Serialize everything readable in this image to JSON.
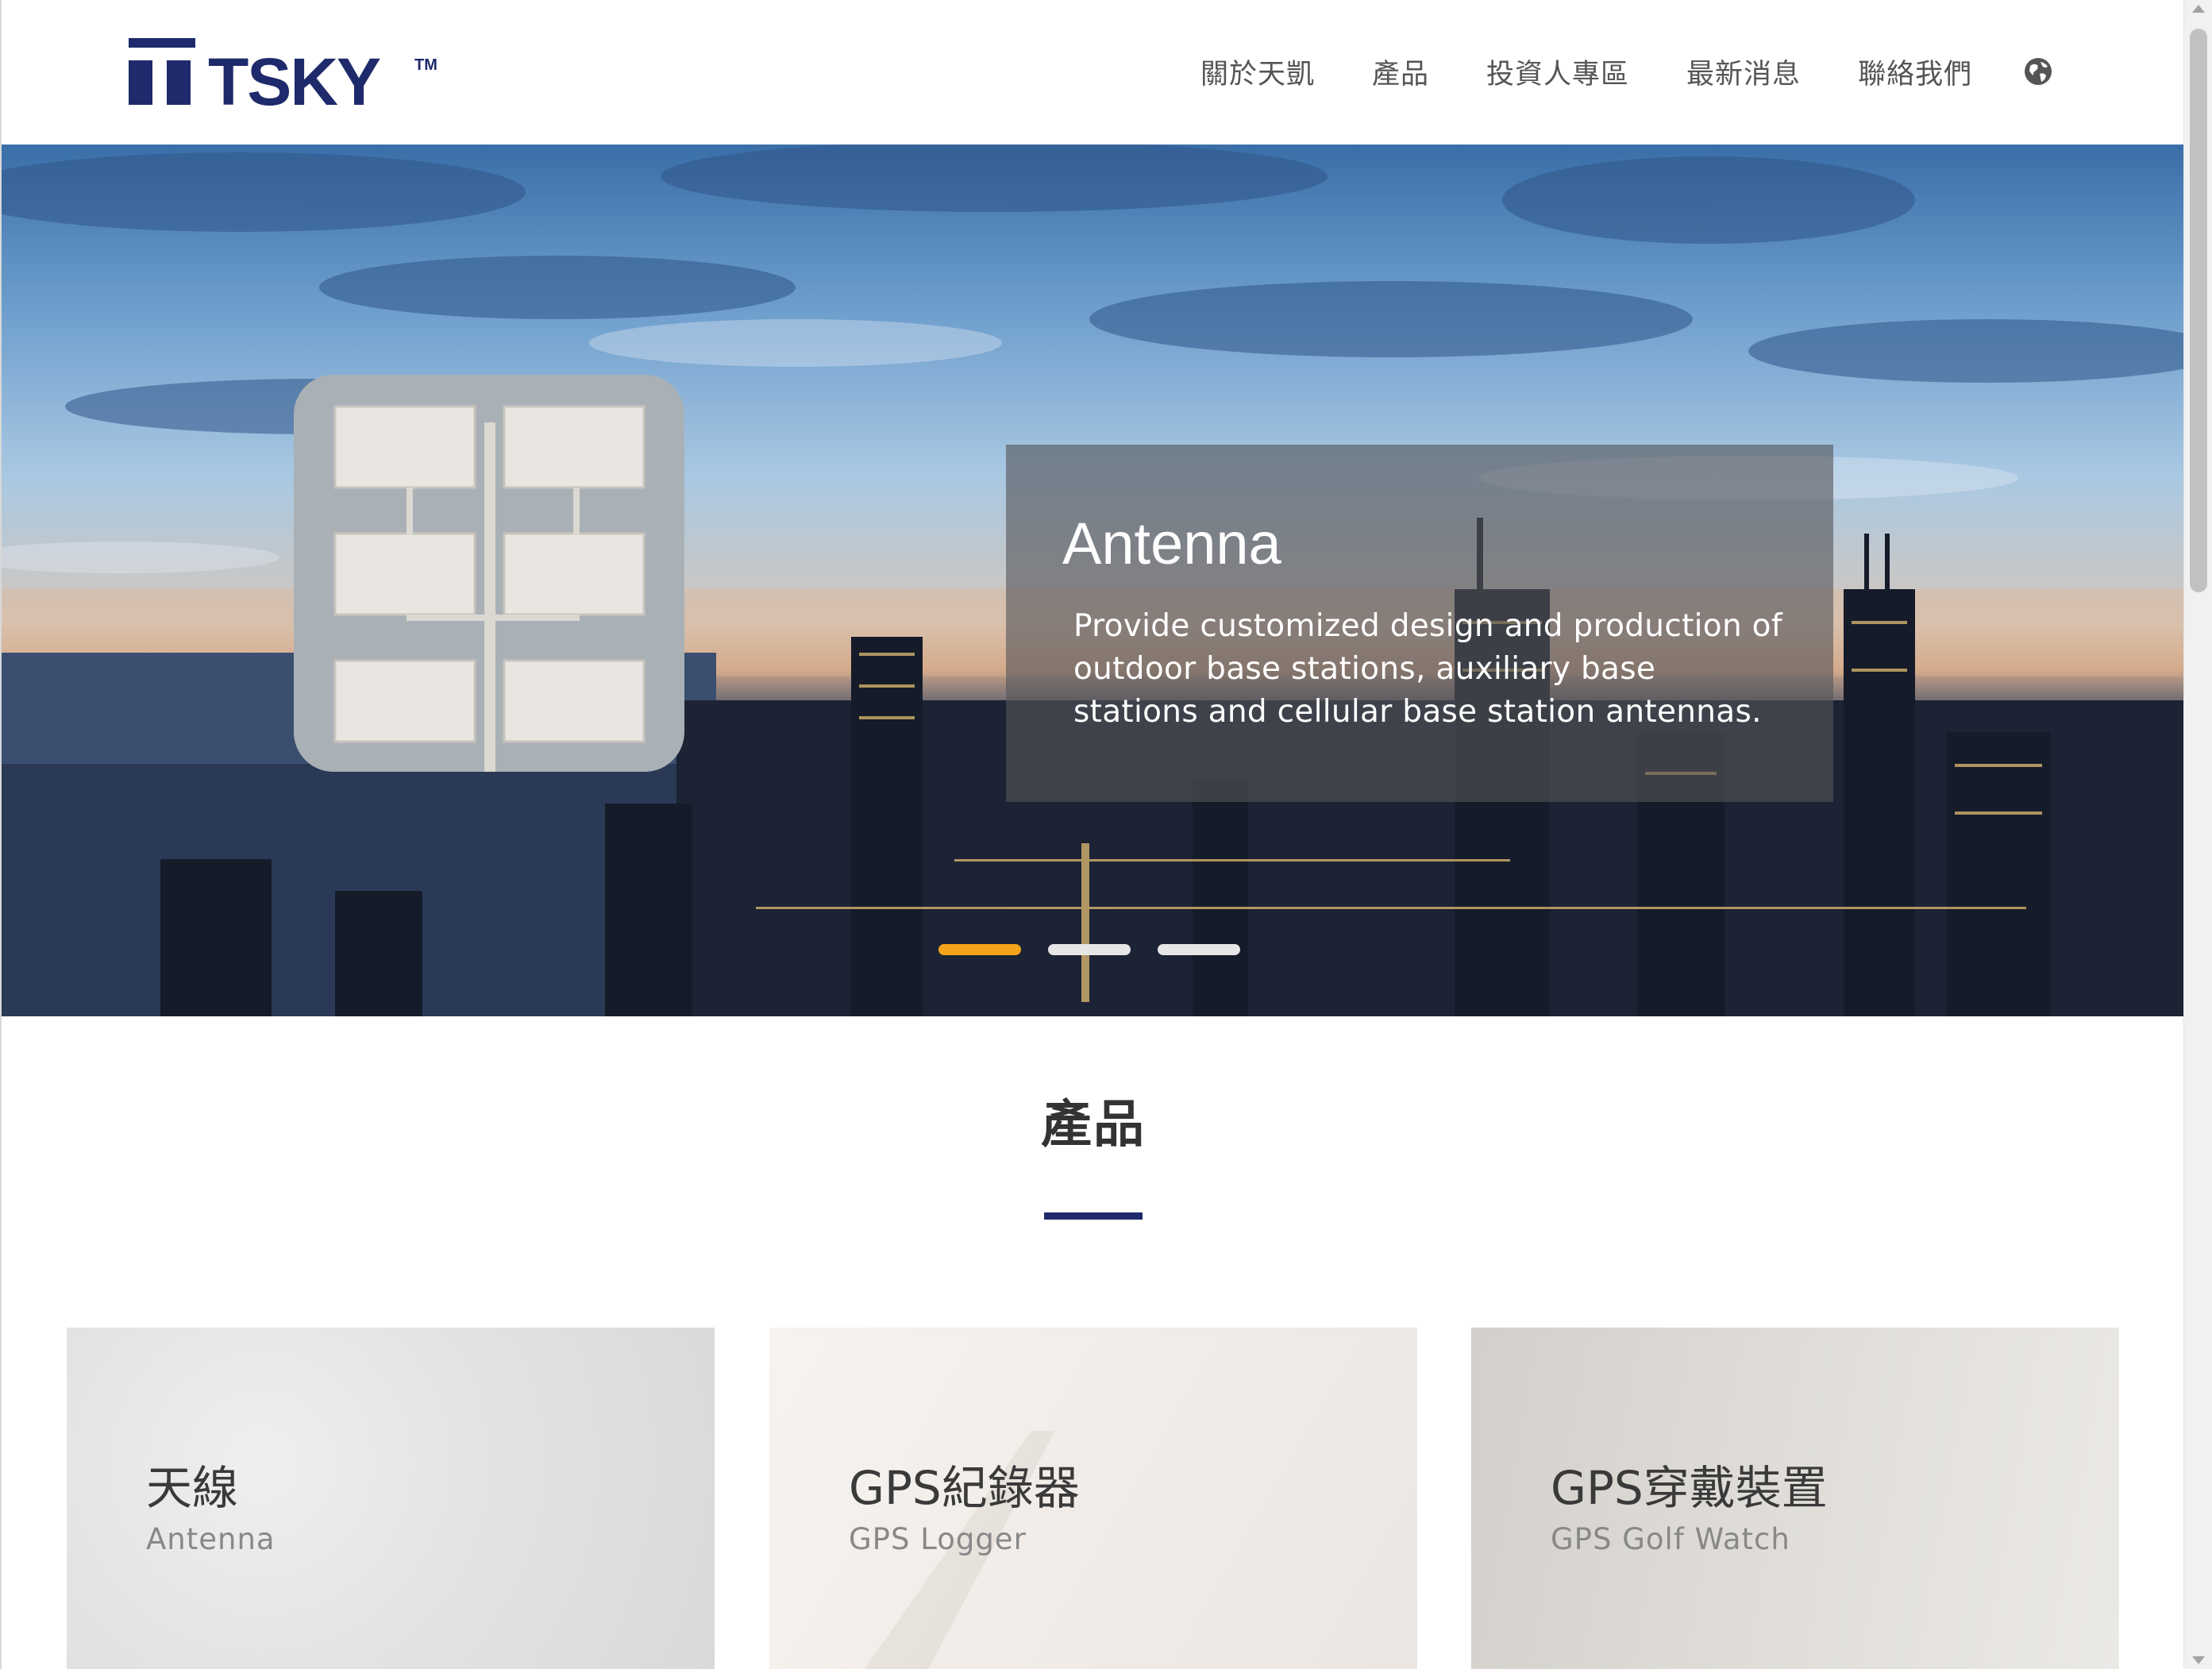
{
  "brand": {
    "name": "TSKY",
    "trademark": "TM",
    "color": "#1e2a6b"
  },
  "nav": {
    "items": [
      {
        "label": "關於天凱"
      },
      {
        "label": "產品"
      },
      {
        "label": "投資人專區"
      },
      {
        "label": "最新消息"
      },
      {
        "label": "聯絡我們"
      }
    ],
    "language_icon": "globe-icon"
  },
  "hero": {
    "title": "Antenna",
    "description": "Provide customized design and production of outdoor base stations, auxiliary base stations and cellular base station antennas.",
    "slides_total": 3,
    "active_slide": 1,
    "active_color": "#f5a31a"
  },
  "products": {
    "heading": "產品",
    "accent_color": "#1e2a6b",
    "cards": [
      {
        "title": "天線",
        "subtitle": "Antenna"
      },
      {
        "title": "GPS紀錄器",
        "subtitle": "GPS Logger"
      },
      {
        "title": "GPS穿戴裝置",
        "subtitle": "GPS Golf Watch"
      }
    ]
  }
}
